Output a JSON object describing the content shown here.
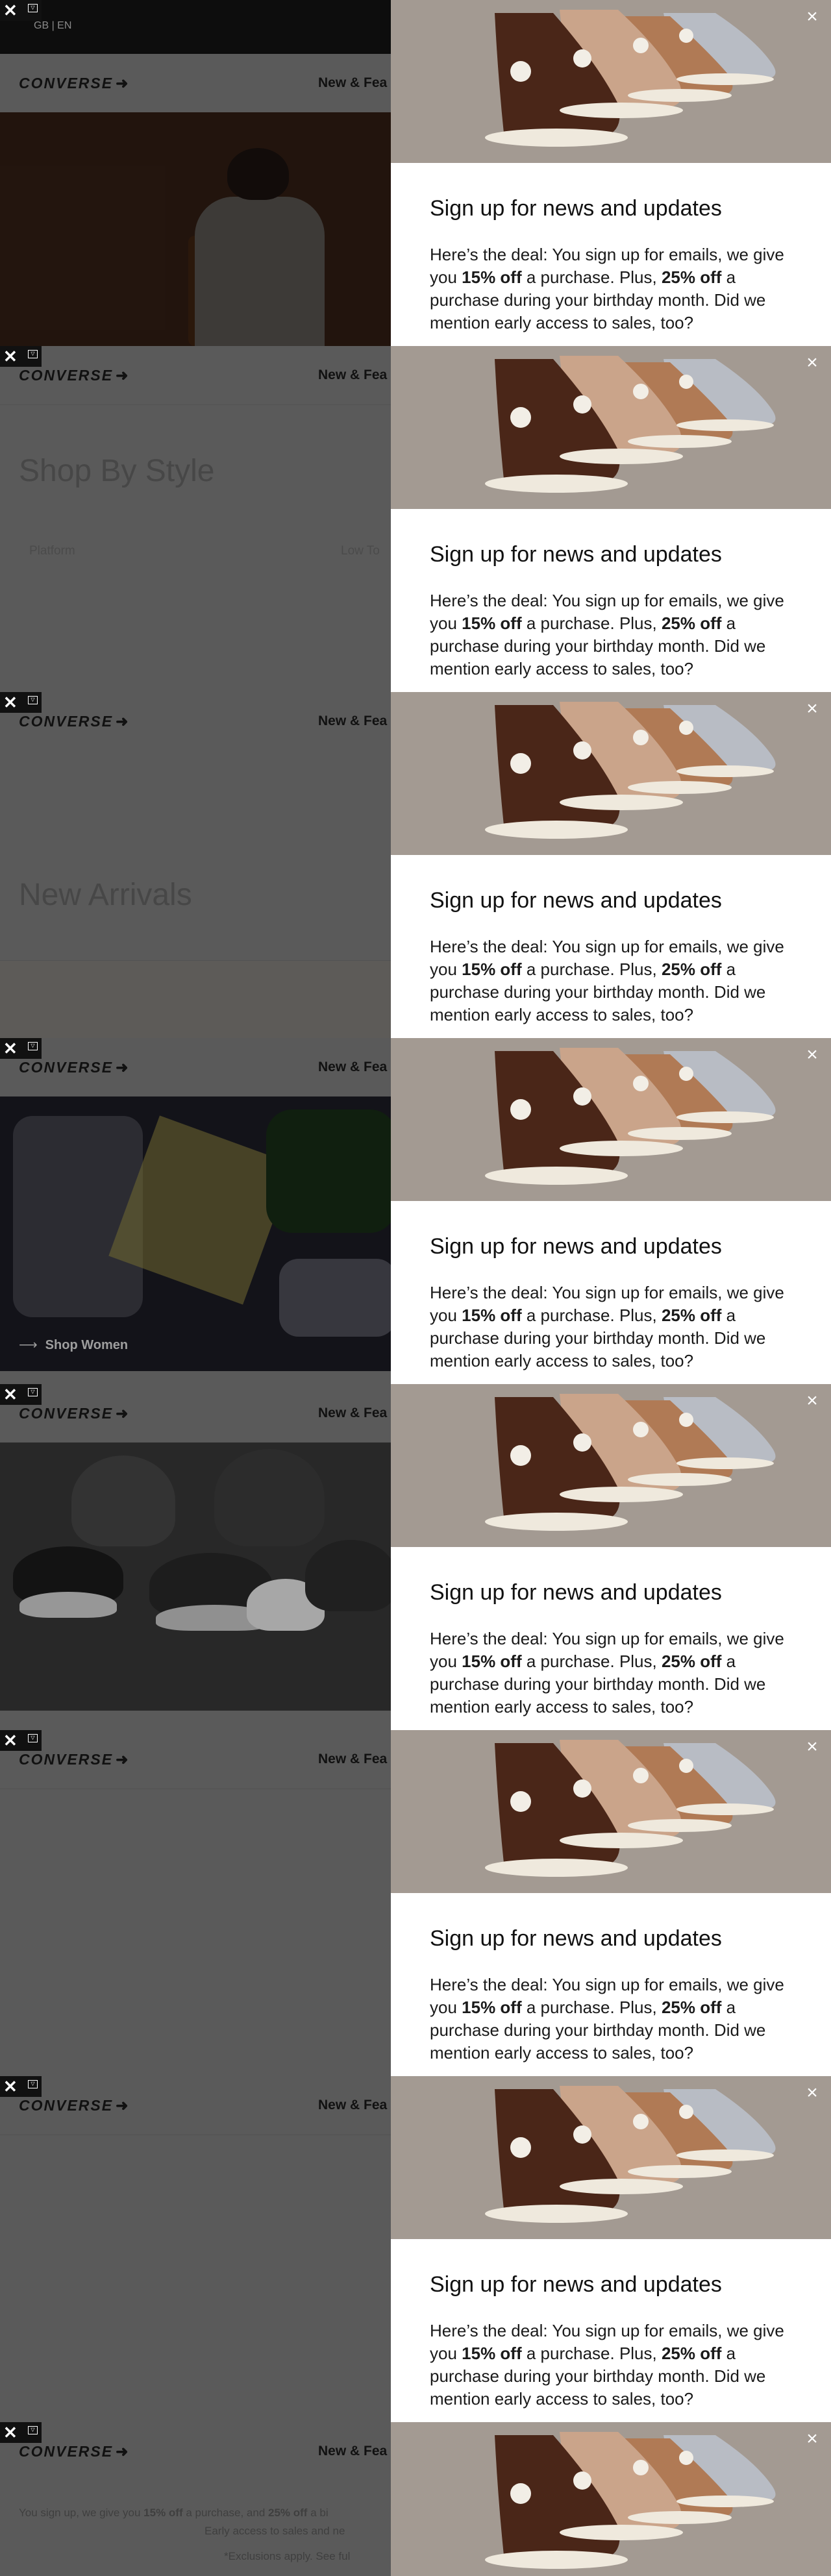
{
  "header": {
    "locale": "GB | EN",
    "logo_text": "CONVERSE",
    "nav_link": "New & Fea"
  },
  "sections": {
    "shop_by_style_title": "Shop By Style",
    "filter_platform": "Platform",
    "filter_low_top": "Low To",
    "new_arrivals_title": "New Arrivals",
    "shop_women_link": "Shop Women"
  },
  "footer": {
    "line1_pre": "You sign up, we give you ",
    "line1_pct1": "15% off",
    "line1_mid": " a purchase, and ",
    "line1_pct2": "25% off",
    "line1_post": " a bi",
    "line2": "Early access to sales and ne",
    "line3": "*Exclusions apply. See ful"
  },
  "modal": {
    "title": "Sign up for news and updates",
    "body_pre": "Here’s the deal: You sign up for emails, we give you ",
    "body_pct1": "15% off",
    "body_mid": " a purchase. Plus, ",
    "body_pct2": "25% off",
    "body_post": " a purchase during your birthday month. Did we mention early access to sales, too?",
    "close_symbol": "×",
    "image_icon": "converse-chuck-70-sneakers-image"
  },
  "tracker_badge": {
    "icon": "close-icon",
    "mini_icon": "ad-choices-icon"
  },
  "colors": {
    "overlay": "#595959",
    "modal_bg": "#ffffff",
    "image_bg": "#a39a92",
    "dark_bar": "#0d0d0d"
  }
}
